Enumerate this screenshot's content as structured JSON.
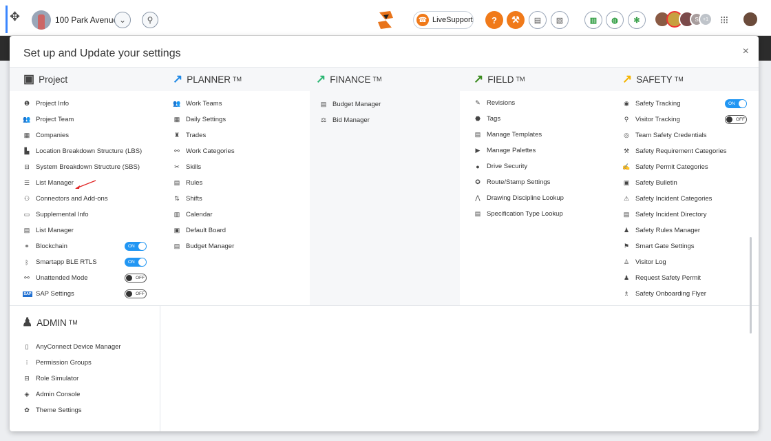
{
  "topbar": {
    "project_name": "100 Park Avenue",
    "live_support": "LiveSupport",
    "avatar_badge_s": "S",
    "avatar_badge_count": "+1"
  },
  "modal": {
    "title": "Set up and Update your settings",
    "close": "×"
  },
  "project": {
    "header": "Project",
    "items": [
      {
        "label": "Project Info",
        "icon": "info-icon",
        "glyph": "❶"
      },
      {
        "label": "Project Team",
        "icon": "team-icon",
        "glyph": "👥"
      },
      {
        "label": "Companies",
        "icon": "companies-icon",
        "glyph": "▦"
      },
      {
        "label": "Location Breakdown Structure (LBS)",
        "icon": "lbs-icon",
        "glyph": "▙"
      },
      {
        "label": "System Breakdown Structure (SBS)",
        "icon": "sbs-icon",
        "glyph": "⊟"
      },
      {
        "label": "List Manager",
        "icon": "list-icon",
        "glyph": "☰"
      },
      {
        "label": "Connectors and Add-ons",
        "icon": "connector-icon",
        "glyph": "⚇"
      },
      {
        "label": "Supplemental Info",
        "icon": "supplemental-icon",
        "glyph": "▭"
      },
      {
        "label": "List Manager",
        "icon": "list-dark-icon",
        "glyph": "▤"
      },
      {
        "label": "Blockchain",
        "icon": "blockchain-icon",
        "glyph": "⚭",
        "toggle": "ON"
      },
      {
        "label": "Smartapp BLE RTLS",
        "icon": "bluetooth-icon",
        "glyph": "ᛒ",
        "toggle": "ON"
      },
      {
        "label": "Unattended Mode",
        "icon": "network-icon",
        "glyph": "⚯",
        "toggle": "OFF"
      },
      {
        "label": "SAP Settings",
        "icon": "sap-icon",
        "glyph": "SAP",
        "toggle": "OFF"
      }
    ]
  },
  "admin": {
    "header": "ADMIN",
    "tm": "TM",
    "items": [
      {
        "label": "AnyConnect Device Manager",
        "icon": "device-icon",
        "glyph": "▯"
      },
      {
        "label": "Permission Groups",
        "icon": "permission-icon",
        "glyph": "⁝"
      },
      {
        "label": "Role Simulator",
        "icon": "role-icon",
        "glyph": "⊟"
      },
      {
        "label": "Admin Console",
        "icon": "console-icon",
        "glyph": "◈"
      },
      {
        "label": "Theme Settings",
        "icon": "theme-icon",
        "glyph": "✿"
      }
    ]
  },
  "planner": {
    "header": "PLANNER",
    "tm": "TM",
    "color": "#1e88e5",
    "items": [
      {
        "label": "Work Teams",
        "icon": "team-icon",
        "glyph": "👥"
      },
      {
        "label": "Daily Settings",
        "icon": "calendar-icon",
        "glyph": "▦"
      },
      {
        "label": "Trades",
        "icon": "worker-icon",
        "glyph": "♜"
      },
      {
        "label": "Work Categories",
        "icon": "category-icon",
        "glyph": "⚯"
      },
      {
        "label": "Skills",
        "icon": "skills-icon",
        "glyph": "✂"
      },
      {
        "label": "Rules",
        "icon": "rules-icon",
        "glyph": "▤"
      },
      {
        "label": "Shifts",
        "icon": "shifts-icon",
        "glyph": "⇅"
      },
      {
        "label": "Calendar",
        "icon": "calendar-grid-icon",
        "glyph": "▥"
      },
      {
        "label": "Default Board",
        "icon": "board-icon",
        "glyph": "▣"
      },
      {
        "label": "Budget Manager",
        "icon": "budget-icon",
        "glyph": "▤"
      }
    ]
  },
  "finance": {
    "header": "FINANCE",
    "tm": "TM",
    "color": "#2bb673",
    "items": [
      {
        "label": "Budget Manager",
        "icon": "budget-icon",
        "glyph": "▤"
      },
      {
        "label": "Bid Manager",
        "icon": "bid-icon",
        "glyph": "⚖"
      }
    ]
  },
  "field": {
    "header": "FIELD",
    "tm": "TM",
    "color": "#3a8a1e",
    "items": [
      {
        "label": "Revisions",
        "icon": "revisions-icon",
        "glyph": "✎"
      },
      {
        "label": "Tags",
        "icon": "tag-icon",
        "glyph": "⬣"
      },
      {
        "label": "Manage Templates",
        "icon": "template-icon",
        "glyph": "▤"
      },
      {
        "label": "Manage Palettes",
        "icon": "palette-icon",
        "glyph": "▶"
      },
      {
        "label": "Drive Security",
        "icon": "security-icon",
        "glyph": "●"
      },
      {
        "label": "Route/Stamp Settings",
        "icon": "stamp-icon",
        "glyph": "✪"
      },
      {
        "label": "Drawing Discipline Lookup",
        "icon": "drawing-icon",
        "glyph": "⋀"
      },
      {
        "label": "Specification Type Lookup",
        "icon": "spec-icon",
        "glyph": "▤"
      }
    ]
  },
  "safety": {
    "header": "SAFETY",
    "tm": "TM",
    "color": "#f5b400",
    "items": [
      {
        "label": "Safety Tracking",
        "icon": "tracking-icon",
        "glyph": "◉",
        "toggle": "ON"
      },
      {
        "label": "Visitor Tracking",
        "icon": "location-icon",
        "glyph": "⚲",
        "toggle": "OFF"
      },
      {
        "label": "Team Safety Credentials",
        "icon": "credentials-icon",
        "glyph": "◎"
      },
      {
        "label": "Safety Requirement Categories",
        "icon": "requirement-icon",
        "glyph": "⚒"
      },
      {
        "label": "Safety Permit Categories",
        "icon": "permit-icon",
        "glyph": "✍"
      },
      {
        "label": "Safety Bulletin",
        "icon": "bulletin-icon",
        "glyph": "▣"
      },
      {
        "label": "Safety Incident Categories",
        "icon": "incident-icon",
        "glyph": "⚠"
      },
      {
        "label": "Safety Incident Directory",
        "icon": "directory-icon",
        "glyph": "▤"
      },
      {
        "label": "Safety Rules Manager",
        "icon": "rules-manager-icon",
        "glyph": "♟"
      },
      {
        "label": "Smart Gate Settings",
        "icon": "gate-icon",
        "glyph": "⚑"
      },
      {
        "label": "Visitor Log",
        "icon": "visitor-icon",
        "glyph": "♙"
      },
      {
        "label": "Request Safety Permit",
        "icon": "request-icon",
        "glyph": "♟"
      },
      {
        "label": "Safety Onboarding Flyer",
        "icon": "flyer-icon",
        "glyph": "♗"
      }
    ]
  }
}
